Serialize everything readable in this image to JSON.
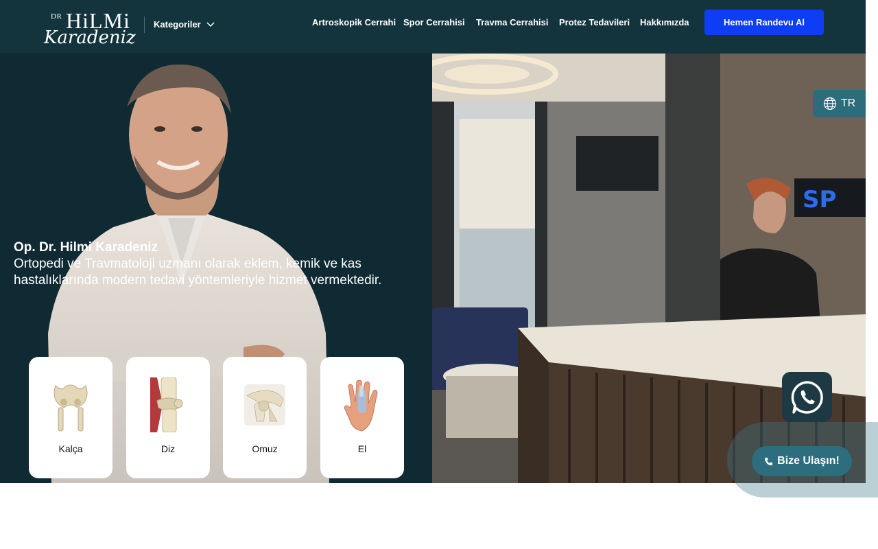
{
  "brand": {
    "logo_dr": "DR",
    "logo_first": "HiLMi",
    "logo_last": "Karadeniz"
  },
  "header": {
    "categories_label": "Kategoriler",
    "nav": [
      "Artroskopik Cerrahi",
      "Spor Cerrahisi",
      "Travma Cerrahisi",
      "Protez Tedavileri",
      "Hakkımızda"
    ],
    "cta_label": "Hemen Randevu Al"
  },
  "hero": {
    "name": "Op. Dr. Hilmi Karadeniz",
    "description": "Ortopedi ve Travmatoloji uzmanı olarak eklem, kemik ve kas hastalıklarında modern tedavi yöntemleriyle hizmet vermektedir.",
    "sign_text": "SP"
  },
  "categories": [
    {
      "label": "Kalça",
      "icon": "hip-bone-icon"
    },
    {
      "label": "Diz",
      "icon": "knee-joint-icon"
    },
    {
      "label": "Omuz",
      "icon": "shoulder-joint-icon"
    },
    {
      "label": "El",
      "icon": "hand-icon"
    }
  ],
  "floating": {
    "language": "TR",
    "contact_label": "Bize Ulaşın!"
  },
  "colors": {
    "header_bg": "#14343d",
    "cta_bg": "#0d3df5",
    "hero_left_bg": "#0f2a33",
    "accent_teal": "#2c6e7e"
  }
}
